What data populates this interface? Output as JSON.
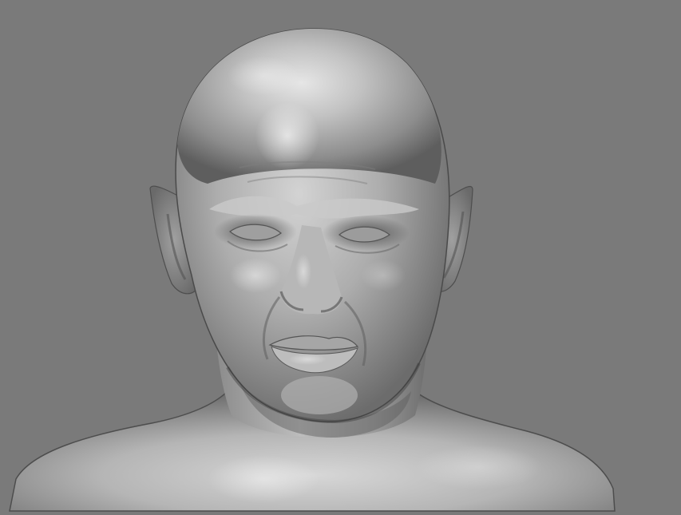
{
  "scene": {
    "background_color": "#7a7a7a",
    "subject": "sculpted-clay-head-bust",
    "material": "matte-grey-clay",
    "colors": {
      "clay_light": "#d8d8d8",
      "clay_mid": "#a9a9a9",
      "clay_dark": "#5c5c5c",
      "clay_shadow": "#3f3f3f",
      "specular": "#f2f2f2"
    }
  }
}
